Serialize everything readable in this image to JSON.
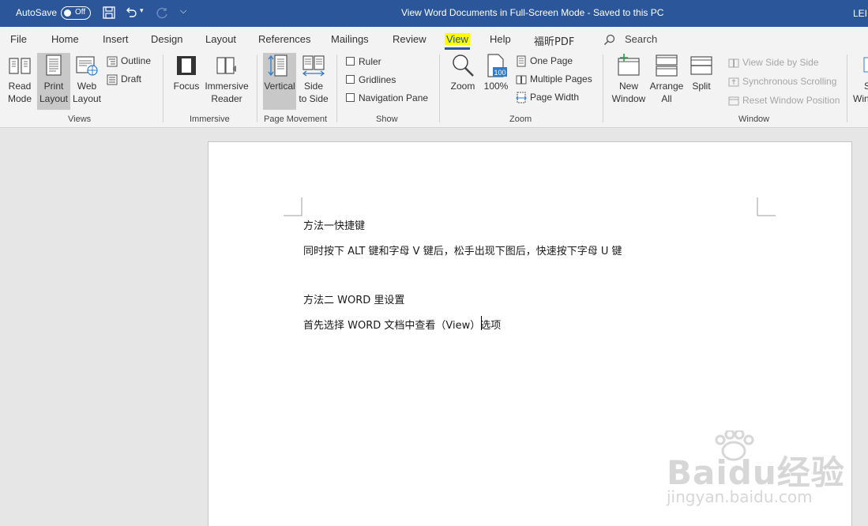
{
  "titlebar": {
    "autosave_label": "AutoSave",
    "autosave_state": "Off",
    "doc_title": "View Word Documents in Full-Screen Mode  -  Saved to this PC",
    "user": "LEI",
    "bg_color": "#2b579a"
  },
  "tabs": {
    "items": [
      "File",
      "Home",
      "Insert",
      "Design",
      "Layout",
      "References",
      "Mailings",
      "Review",
      "View",
      "Help",
      "福昕PDF"
    ],
    "active": "View",
    "search_label": "Search"
  },
  "ribbon": {
    "views": {
      "label": "Views",
      "read_mode": [
        "Read",
        "Mode"
      ],
      "print_layout": [
        "Print",
        "Layout"
      ],
      "web_layout": [
        "Web",
        "Layout"
      ],
      "outline": "Outline",
      "draft": "Draft"
    },
    "immersive": {
      "label": "Immersive",
      "focus": "Focus",
      "immersive_reader": [
        "Immersive",
        "Reader"
      ]
    },
    "page_movement": {
      "label": "Page Movement",
      "vertical": "Vertical",
      "side_to_side": [
        "Side",
        "to Side"
      ]
    },
    "show": {
      "label": "Show",
      "ruler": "Ruler",
      "gridlines": "Gridlines",
      "navigation_pane": "Navigation Pane"
    },
    "zoom": {
      "label": "Zoom",
      "zoom": "Zoom",
      "hundred": "100%",
      "hundred_icon_text": "100",
      "one_page": "One Page",
      "multiple_pages": "Multiple Pages",
      "page_width": "Page Width"
    },
    "window": {
      "label": "Window",
      "new_window": [
        "New",
        "Window"
      ],
      "arrange_all": [
        "Arrange",
        "All"
      ],
      "split": "Split",
      "view_side_by_side": "View Side by Side",
      "synchronous_scrolling": "Synchronous Scrolling",
      "reset_window_position": "Reset Window Position",
      "switch_windows_partial": [
        "S",
        "Win"
      ]
    }
  },
  "document": {
    "lines": [
      "方法一快捷键",
      "同时按下 ALT 键和字母 V 键后，松手出现下图后，快速按下字母 U 键",
      "方法二 WORD 里设置",
      "首先选择 WORD 文档中查看（View）选项"
    ]
  },
  "watermark": {
    "logo": "Baidu经验",
    "url": "jingyan.baidu.com"
  }
}
